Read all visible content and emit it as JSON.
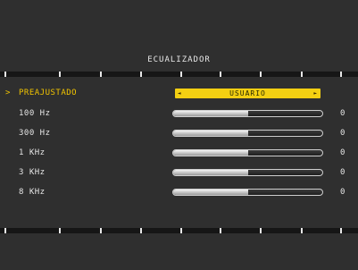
{
  "title": "ECUALIZADOR",
  "cursor": ">",
  "preset": {
    "label": "PREAJUSTADO",
    "value": "USUARIO",
    "left_arrow": "◄",
    "right_arrow": "►"
  },
  "bands": [
    {
      "label": "100 Hz",
      "value": "0",
      "level": 0.5
    },
    {
      "label": "300 Hz",
      "value": "0",
      "level": 0.5
    },
    {
      "label": "1 KHz",
      "value": "0",
      "level": 0.5
    },
    {
      "label": "3 KHz",
      "value": "0",
      "level": 0.5
    },
    {
      "label": "8 KHz",
      "value": "0",
      "level": 0.5
    }
  ]
}
